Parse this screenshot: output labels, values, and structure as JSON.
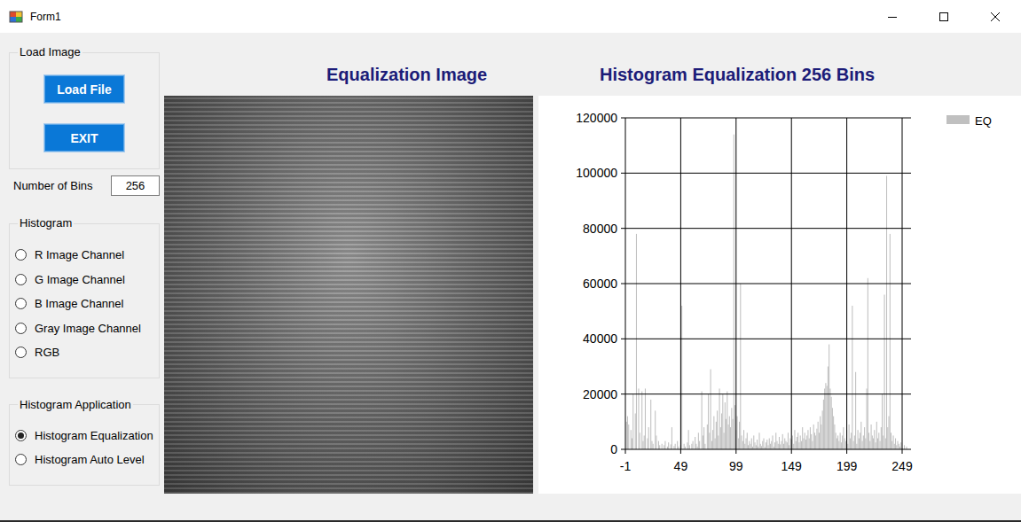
{
  "window": {
    "title": "Form1"
  },
  "load_image": {
    "title": "Load Image",
    "buttons": [
      "Load File",
      "EXIT"
    ]
  },
  "bins": {
    "label": "Number of Bins",
    "value": "256"
  },
  "histogram_group": {
    "title": "Histogram",
    "options": [
      {
        "label": "R Image Channel",
        "selected": false
      },
      {
        "label": "G Image Channel",
        "selected": false
      },
      {
        "label": "B Image Channel",
        "selected": false
      },
      {
        "label": "Gray Image Channel",
        "selected": false
      },
      {
        "label": "RGB",
        "selected": false
      }
    ]
  },
  "application_group": {
    "title": "Histogram Application",
    "options": [
      {
        "label": "Histogram Equalization",
        "selected": true
      },
      {
        "label": "Histogram Auto Level",
        "selected": false
      }
    ]
  },
  "image_panel": {
    "title": "Equalization Image"
  },
  "chart": {
    "title": "Histogram Equalization 256 Bins",
    "y_ticks": [
      "0",
      "20000",
      "40000",
      "60000",
      "80000",
      "100000",
      "120000"
    ],
    "x_ticks": [
      "-1",
      "49",
      "99",
      "149",
      "199",
      "249"
    ],
    "series": [
      {
        "name": "EQ",
        "values": [
          10000,
          12000,
          9000,
          0,
          7000,
          4000,
          20000,
          0,
          13000,
          78000,
          0,
          22000,
          6000,
          0,
          21000,
          3000,
          5000,
          22000,
          0,
          4000,
          8000,
          0,
          18000,
          3000,
          2000,
          0,
          14000,
          5000,
          0,
          3000,
          1500,
          0,
          2000,
          0,
          1500,
          3000,
          0,
          1000,
          2500,
          0,
          1800,
          8000,
          0,
          1200,
          2000,
          0,
          3000,
          1000,
          0,
          1500,
          52000,
          0,
          2000,
          1000,
          0,
          2500,
          7000,
          1500,
          0,
          2000,
          3000,
          0,
          4500,
          2000,
          1000,
          6000,
          3000,
          0,
          21000,
          5000,
          8000,
          2000,
          0,
          9000,
          20000,
          6000,
          29000,
          3000,
          7000,
          12000,
          4000,
          10000,
          14000,
          5000,
          22000,
          8000,
          13000,
          20000,
          6000,
          17000,
          11000,
          21000,
          9000,
          12000,
          8000,
          15000,
          11000,
          114000,
          16000,
          7000,
          12000,
          4000,
          10000,
          60000,
          5000,
          3000,
          7000,
          2000,
          4000,
          6000,
          1500,
          3000,
          2000,
          4000,
          1000,
          5000,
          2500,
          1500,
          3500,
          1000,
          6000,
          2000,
          1200,
          3000,
          4000,
          800,
          2500,
          3500,
          1500,
          4000,
          2000,
          3000,
          5000,
          1000,
          2500,
          6000,
          3000,
          2000,
          4500,
          1800,
          3000,
          5500,
          2000,
          4000,
          3000,
          2500,
          6000,
          1500,
          4000,
          3500,
          5000,
          2000,
          7000,
          3000,
          4500,
          6000,
          2500,
          5000,
          3000,
          8000,
          4000,
          6000,
          3500,
          5000,
          7000,
          4000,
          8000,
          5500,
          3000,
          9000,
          6000,
          5000,
          7500,
          10000,
          6000,
          12000,
          9000,
          14000,
          18000,
          22000,
          24000,
          23000,
          30000,
          38000,
          22000,
          19000,
          15000,
          12000,
          9000,
          6000,
          4000,
          5000,
          3000,
          6000,
          2500,
          5000,
          8000,
          4000,
          3000,
          7000,
          2000,
          9000,
          4000,
          6000,
          52000,
          3000,
          5000,
          28000,
          2000,
          7000,
          4000,
          6000,
          10000,
          3000,
          5000,
          8000,
          4000,
          22000,
          62000,
          6000,
          3000,
          9000,
          5000,
          4000,
          7000,
          2500,
          10000,
          4000,
          6000,
          3000,
          8000,
          20000,
          5000,
          56000,
          4000,
          99000,
          8000,
          12000,
          78000,
          6000,
          3000,
          5000,
          2000,
          4000,
          1500,
          3000,
          2000,
          1000,
          2500,
          500,
          0,
          1500,
          0,
          1000,
          0,
          0
        ]
      }
    ]
  }
}
